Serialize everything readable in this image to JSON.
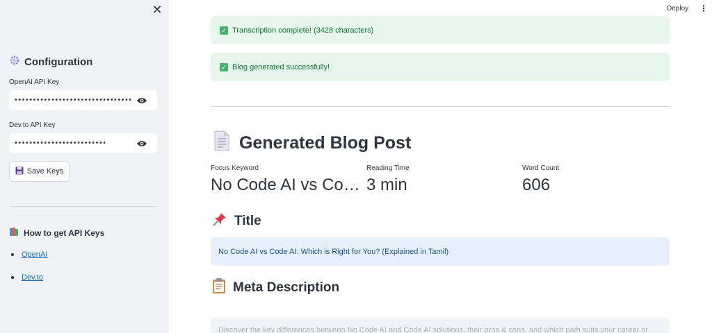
{
  "sidebar": {
    "close_icon": "close-icon",
    "config_heading": "Configuration",
    "config_icon": "gear-icon",
    "openai_label": "OpenAI API Key",
    "openai_value": "••••••••••••••••••••••••••••••••••••••••••••••••••",
    "devto_label": "Dev.to API Key",
    "devto_value": "•••••••••••••••••••••••••",
    "save_label": "Save Keys",
    "save_icon": "floppy-disk-icon",
    "howto_heading": "How to get API Keys",
    "howto_icon": "books-icon",
    "links": [
      {
        "label": "OpenAI"
      },
      {
        "label": "Dev.to"
      }
    ]
  },
  "header": {
    "deploy_label": "Deploy",
    "menu_icon": "kebab-menu-icon"
  },
  "main": {
    "alerts": [
      {
        "text": "Transcription complete! (3428 characters)"
      },
      {
        "text": "Blog generated successfully!"
      }
    ],
    "blog_heading": "Generated Blog Post",
    "blog_icon": "document-icon",
    "metrics": [
      {
        "label": "Focus Keyword",
        "value": "No Code AI vs Co…"
      },
      {
        "label": "Reading Time",
        "value": "3 min"
      },
      {
        "label": "Word Count",
        "value": "606"
      }
    ],
    "title_heading": "Title",
    "title_icon": "pushpin-icon",
    "title_value": "No Code AI vs Code AI: Which is Right for You? (Explained in Tamil)",
    "meta_heading": "Meta Description",
    "meta_icon": "clipboard-icon",
    "meta_value": "Discover the key differences between No Code AI and Code AI solutions, their pros & cons, and which path suits your career or"
  },
  "colors": {
    "sidebar_bg": "#f0f2f6",
    "success_bg": "#e4f7ea",
    "success_text": "#177233",
    "info_bg": "#e6f0fb",
    "info_text": "#1c4f85",
    "link": "#0f6bbf"
  }
}
